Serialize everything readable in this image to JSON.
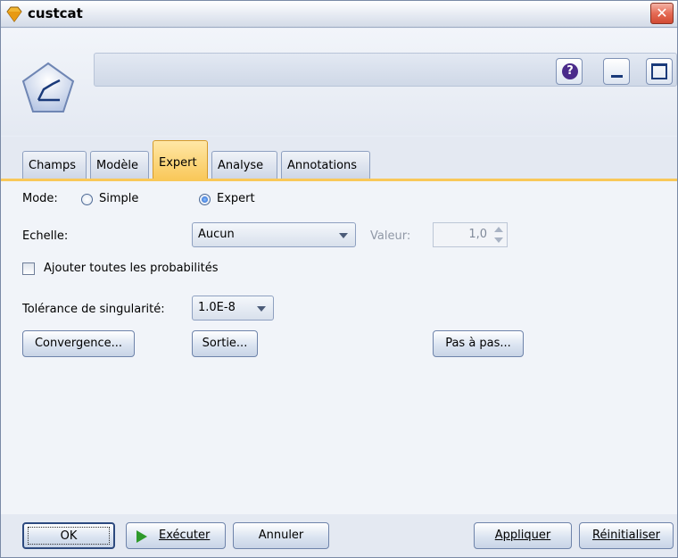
{
  "window": {
    "title": "custcat",
    "close_glyph": "✕"
  },
  "header": {
    "node_icon": "regression-node-icon",
    "name_value": "",
    "help_glyph": "?"
  },
  "tabs": [
    {
      "label": "Champs",
      "active": false
    },
    {
      "label": "Modèle",
      "active": false
    },
    {
      "label": "Expert",
      "active": true
    },
    {
      "label": "Analyse",
      "active": false
    },
    {
      "label": "Annotations",
      "active": false
    }
  ],
  "expert": {
    "mode_label": "Mode:",
    "mode_options": {
      "simple": "Simple",
      "expert": "Expert"
    },
    "mode_selected": "Expert",
    "scale_label": "Echelle:",
    "scale_value": "Aucun",
    "value_label": "Valeur:",
    "value": "1,0",
    "add_probabilities_label": "Ajouter toutes les probabilités",
    "add_probabilities_checked": false,
    "singularity_label": "Tolérance de singularité:",
    "singularity_value": "1.0E-8",
    "convergence_button": "Convergence...",
    "output_button": "Sortie...",
    "stepping_button": "Pas à pas..."
  },
  "footer": {
    "ok": "OK",
    "run": "Exécuter",
    "cancel": "Annuler",
    "apply": "Appliquer",
    "reset": "Réinitialiser"
  },
  "colors": {
    "active_tab": "#f9c85a",
    "panel": "#f1f4f9",
    "accent": "#1e5bc8"
  }
}
